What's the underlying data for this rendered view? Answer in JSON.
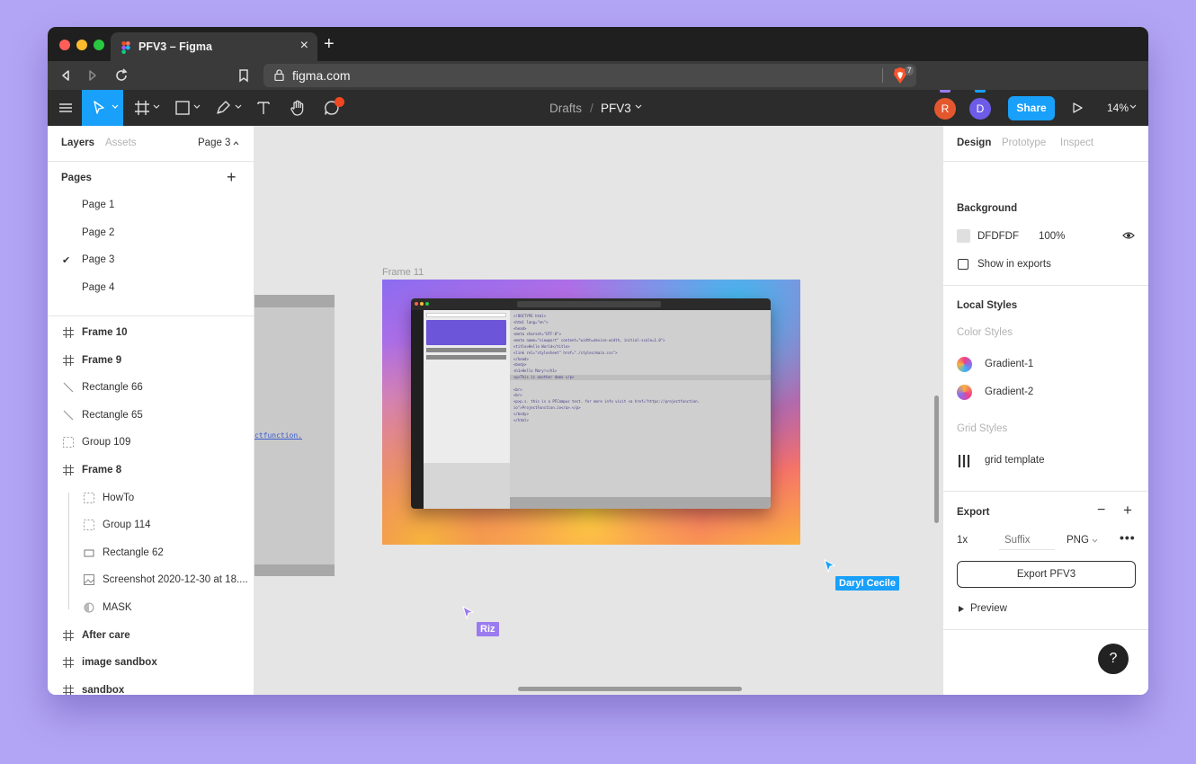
{
  "browser": {
    "tab_title": "PFV3 – Figma",
    "url": "figma.com",
    "brave_count": "7",
    "colors": {
      "close": "#ff5f57",
      "minimize": "#febc2e",
      "maximize": "#28c840"
    }
  },
  "toolbar": {
    "breadcrumb_root": "Drafts",
    "breadcrumb_sep": "/",
    "file_name": "PFV3",
    "avatars": [
      {
        "initial": "R",
        "color": "#e4572e"
      },
      {
        "initial": "D",
        "color": "#6d5ce8"
      }
    ],
    "share_label": "Share",
    "zoom": "14%"
  },
  "left_panel": {
    "tabs": {
      "layers": "Layers",
      "assets": "Assets",
      "page_selector": "Page 3"
    },
    "pages_heading": "Pages",
    "pages": [
      "Page 1",
      "Page 2",
      "Page 3",
      "Page 4"
    ],
    "current_page_index": 2,
    "layers": [
      {
        "label": "Frame 10",
        "icon": "frame-icon",
        "bold": true,
        "indent": 0
      },
      {
        "label": "Frame 9",
        "icon": "frame-icon",
        "bold": true,
        "indent": 0
      },
      {
        "label": "Rectangle 66",
        "icon": "line-icon",
        "bold": false,
        "indent": 0
      },
      {
        "label": "Rectangle 65",
        "icon": "line-icon",
        "bold": false,
        "indent": 0
      },
      {
        "label": "Group 109",
        "icon": "group-icon",
        "bold": false,
        "indent": 0
      },
      {
        "label": "Frame 8",
        "icon": "frame-icon",
        "bold": true,
        "indent": 0
      },
      {
        "label": "HowTo",
        "icon": "group-icon",
        "bold": false,
        "indent": 1
      },
      {
        "label": "Group 114",
        "icon": "group-icon",
        "bold": false,
        "indent": 1
      },
      {
        "label": "Rectangle 62",
        "icon": "rectangle-icon",
        "bold": false,
        "indent": 1
      },
      {
        "label": "Screenshot 2020-12-30 at 18....",
        "icon": "image-icon",
        "bold": false,
        "indent": 1
      },
      {
        "label": "MASK",
        "icon": "mask-icon",
        "bold": false,
        "indent": 1
      },
      {
        "label": "After care",
        "icon": "frame-icon",
        "bold": true,
        "indent": 0
      },
      {
        "label": "image sandbox",
        "icon": "frame-icon",
        "bold": true,
        "indent": 0
      },
      {
        "label": "sandbox",
        "icon": "frame-icon",
        "bold": true,
        "indent": 0
      }
    ]
  },
  "canvas": {
    "frame_label": "Frame 11",
    "ghost_link_text": "ctfunction.",
    "cursors": [
      {
        "name": "Daryl Cecile",
        "color": "#18a0fb"
      },
      {
        "name": "Riz",
        "color": "#9b7bf0"
      }
    ],
    "code_lines": [
      "<!DOCTYPE html>",
      "<html lang=\"en\">",
      "<head>",
      "  <meta charset=\"UTF-8\">",
      "  <meta name=\"viewport\" content=\"width=device-width, initial-scale=1.0\">",
      "  <title>Hello World</title>",
      "  <link rel=\"stylesheet\" href=\"./styles/main.css\">",
      "</head>",
      "<body>",
      "  <h1>Hello Mary!</h1>",
      "  <p>This is another demo </p>",
      "",
      "  <br>",
      "  <br>",
      "  <p>p.s. this is a PFCampus test. for more info visit <a href=\"https://projectfunction.",
      "io\">ProjectFunction.io</a>.</p>",
      "</body>",
      "</html>"
    ]
  },
  "right_panel": {
    "tabs": {
      "design": "Design",
      "prototype": "Prototype",
      "inspect": "Inspect"
    },
    "background": {
      "heading": "Background",
      "hex": "DFDFDF",
      "opacity": "100%",
      "show_in_exports": "Show in exports"
    },
    "local_styles": {
      "heading": "Local Styles",
      "color_styles_label": "Color Styles",
      "colors": [
        "Gradient-1",
        "Gradient-2"
      ],
      "grid_styles_label": "Grid Styles",
      "grids": [
        "grid template"
      ]
    },
    "export": {
      "heading": "Export",
      "scale": "1x",
      "suffix_placeholder": "Suffix",
      "format": "PNG",
      "button_label": "Export PFV3",
      "preview_label": "Preview"
    },
    "help_label": "?"
  }
}
